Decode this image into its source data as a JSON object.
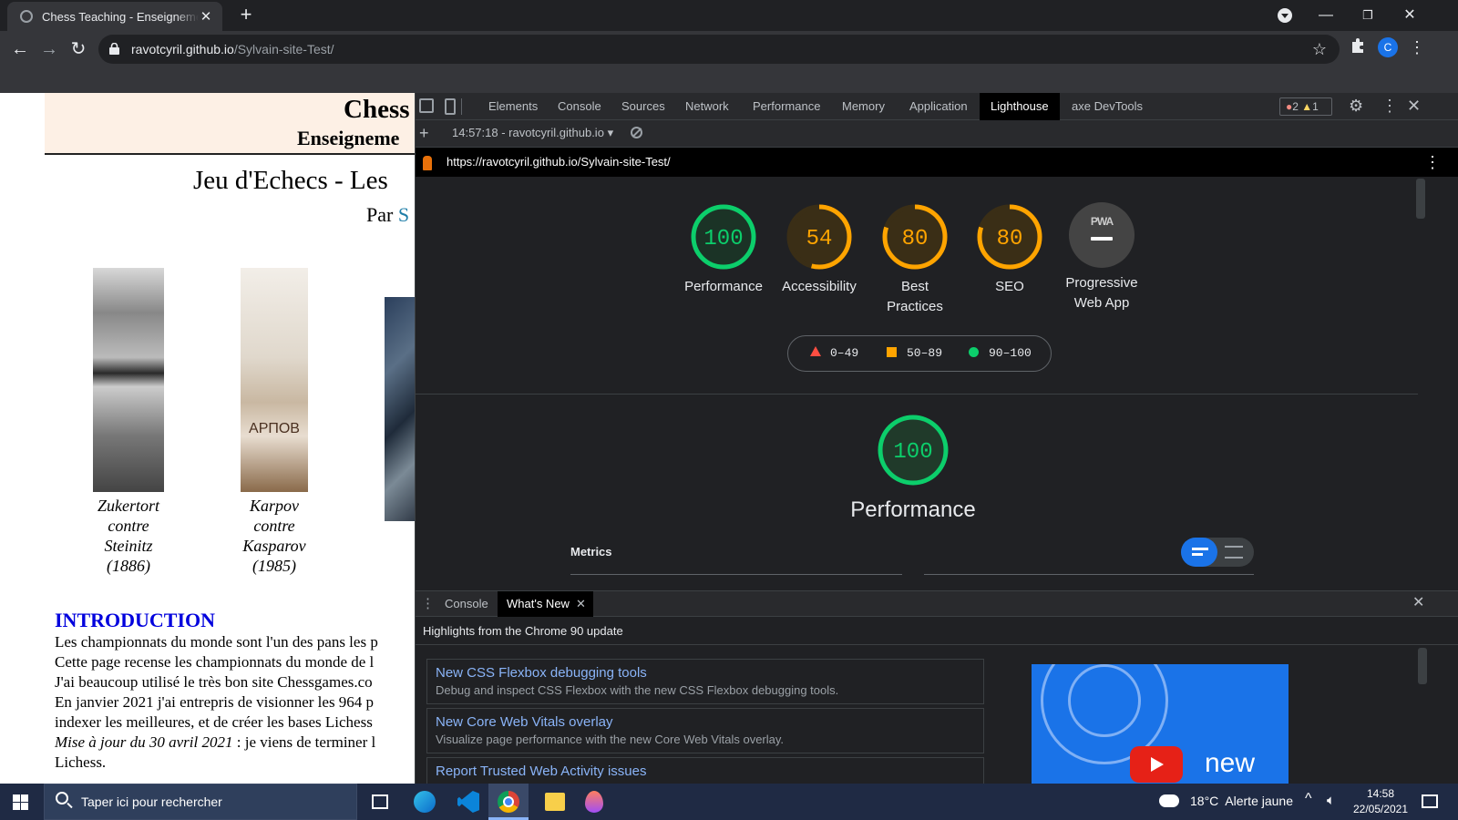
{
  "browser": {
    "tab_title": "Chess Teaching - Enseignement des échecs",
    "new_tab": "+",
    "url_host": "ravotcyril.github.io",
    "url_path": "/Sylvain-site-Test/",
    "profile_initial": "C"
  },
  "page": {
    "header_title": "Chess",
    "header_subtitle": "Enseigneme",
    "main_title": "Jeu d'Echecs - Les",
    "author_prefix": "Par",
    "author_initial": "S",
    "images": [
      {
        "caption": [
          "Zukertort",
          "contre",
          "Steinitz",
          "(1886)"
        ]
      },
      {
        "caption": [
          "Karpov",
          "contre",
          "Kasparov",
          "(1985)"
        ],
        "overlay": "АРПОВ"
      }
    ],
    "intro_heading": "INTRODUCTION",
    "intro_lines": [
      "Les championnats du monde sont l'un des pans les p",
      "Cette page recense les championnats du monde de l",
      "J'ai beaucoup utilisé le très bon site Chessgames.co",
      "En janvier 2021 j'ai entrepris de visionner les 964 p",
      "indexer les meilleures, et de créer les bases Lichess",
      "Lichess."
    ],
    "update_italic": "Mise à jour du 30 avril 2021",
    "update_rest": " : je viens de terminer l"
  },
  "devtools": {
    "tabs": [
      "Elements",
      "Console",
      "Sources",
      "Network",
      "Performance",
      "Memory",
      "Application",
      "Lighthouse",
      "axe DevTools"
    ],
    "active_tab": "Lighthouse",
    "errors": "2",
    "warnings": "1",
    "report_selector": "14:57:18 - ravotcyril.github.io",
    "report_url": "https://ravotcyril.github.io/Sylvain-site-Test/",
    "scores": [
      {
        "value": "100",
        "label1": "Performance",
        "label2": "",
        "color": "#0cce6b",
        "fraction": 1.0
      },
      {
        "value": "54",
        "label1": "Accessibility",
        "label2": "",
        "color": "#ffa400",
        "fraction": 0.54
      },
      {
        "value": "80",
        "label1": "Best",
        "label2": "Practices",
        "color": "#ffa400",
        "fraction": 0.8
      },
      {
        "value": "80",
        "label1": "SEO",
        "label2": "",
        "color": "#ffa400",
        "fraction": 0.8
      }
    ],
    "pwa": {
      "badge": "PWA",
      "label1": "Progressive",
      "label2": "Web App"
    },
    "legend": [
      {
        "text": "0–49",
        "color": "#ff4e42",
        "shape": "triangle"
      },
      {
        "text": "50–89",
        "color": "#ffa400",
        "shape": "square"
      },
      {
        "text": "90–100",
        "color": "#0cce6b",
        "shape": "circle"
      }
    ],
    "perf_big": {
      "value": "100",
      "label": "Performance",
      "color": "#0cce6b",
      "fraction": 1.0
    },
    "metrics_label": "Metrics",
    "drawer": {
      "tabs": [
        "Console",
        "What's New"
      ],
      "active": "What's New",
      "headline": "Highlights from the Chrome 90 update",
      "items": [
        {
          "title": "New CSS Flexbox debugging tools",
          "desc": "Debug and inspect CSS Flexbox with the new CSS Flexbox debugging tools."
        },
        {
          "title": "New Core Web Vitals overlay",
          "desc": "Visualize page performance with the new Core Web Vitals overlay."
        },
        {
          "title": "Report Trusted Web Activity issues",
          "desc": ""
        }
      ],
      "video_text": "new"
    }
  },
  "taskbar": {
    "search_placeholder": "Taper ici pour rechercher",
    "weather": "18°C  Alerte jaune",
    "time": "14:58",
    "date": "22/05/2021"
  }
}
